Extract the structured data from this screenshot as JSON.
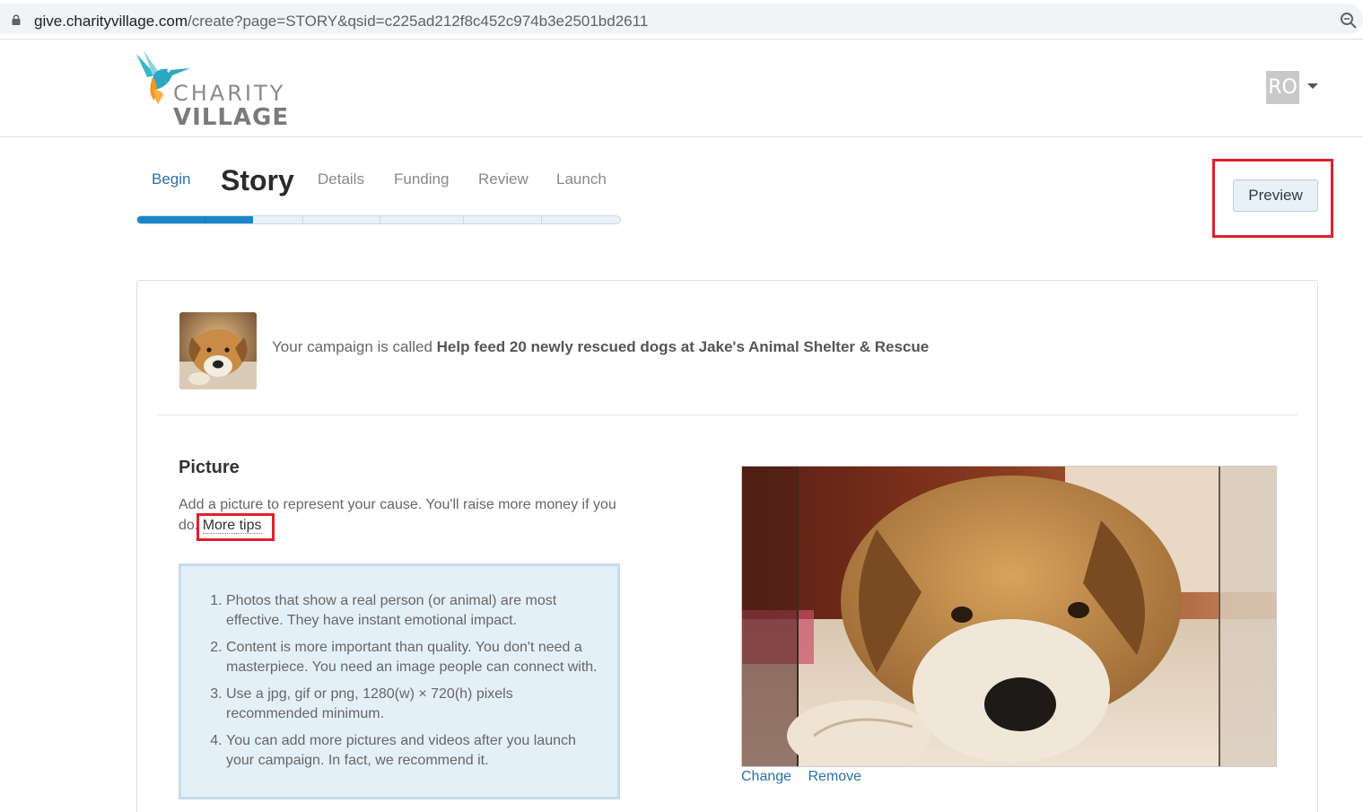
{
  "browser": {
    "url_host": "give.charityvillage.com",
    "url_path": "/create?page=STORY&qsid=c225ad212f8c452c974b3e2501bd2611"
  },
  "header": {
    "logo_line1": "CHARITY",
    "logo_line2": "VILLAGE",
    "avatar_initials": "RO"
  },
  "steps": [
    {
      "label": "Begin",
      "state": "done"
    },
    {
      "label": "Story",
      "state": "current"
    },
    {
      "label": "Details",
      "state": "todo"
    },
    {
      "label": "Funding",
      "state": "todo"
    },
    {
      "label": "Review",
      "state": "todo"
    },
    {
      "label": "Launch",
      "state": "todo"
    }
  ],
  "progress_fraction": 0.24,
  "preview_label": "Preview",
  "campaign": {
    "prefix": "Your campaign is called ",
    "name": "Help feed 20 newly rescued dogs at Jake's Animal Shelter & Rescue"
  },
  "picture": {
    "title": "Picture",
    "intro": "Add a picture to represent your cause. You'll raise more money if you do.",
    "more_tips": "More tips",
    "tips": [
      "Photos that show a real person (or animal) are most effective. They have instant emotional impact.",
      "Content is more important than quality. You don't need a masterpiece. You need an image people can connect with.",
      "Use a jpg, gif or png, 1280(w) × 720(h) pixels recommended minimum.",
      "You can add more pictures and videos after you launch your campaign. In fact, we recommend it."
    ],
    "change_label": "Change",
    "remove_label": "Remove"
  },
  "colors": {
    "accent": "#1a86c8",
    "highlight": "#e0202a",
    "tips_bg": "#e4f0f7"
  }
}
